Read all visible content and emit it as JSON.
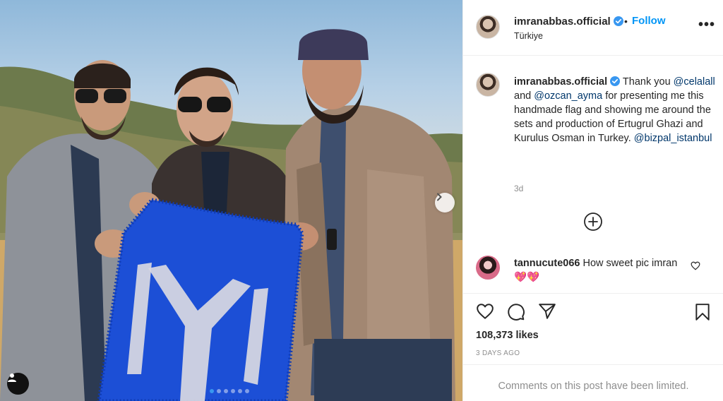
{
  "post": {
    "username": "imranabbas.official",
    "location": "Türkiye",
    "follow_label": "Follow",
    "separator": "•",
    "more_label": "•••"
  },
  "caption": {
    "username": "imranabbas.official",
    "text_1": " Thank you ",
    "mention_1": "@celalall",
    "text_2": " and ",
    "mention_2": "@ozcan_ayma",
    "text_3": " for presenting me this handmade flag and showing me around the sets and production of Ertugrul Ghazi and Kurulus Osman in Turkey. ",
    "mention_3": "@bizpal_istanbul",
    "time": "3d"
  },
  "comment": {
    "username": "tannucute066",
    "text": " How sweet pic imran ",
    "emoji": "💖💖"
  },
  "stats": {
    "likes": "108,373 likes",
    "posted": "3 DAYS AGO",
    "comments_limited": "Comments on this post have been limited."
  },
  "carousel": {
    "slides": 6,
    "active_index": 0
  },
  "colors": {
    "accent": "#0095f6",
    "verified": "#3897f0",
    "flag_blue": "#1c4fd6"
  },
  "icons": [
    "verified-badge-icon",
    "more-options-icon",
    "load-more-comments-icon",
    "like-heart-icon",
    "comment-icon",
    "share-icon",
    "save-bookmark-icon",
    "next-slide-icon",
    "user-tag-icon"
  ]
}
